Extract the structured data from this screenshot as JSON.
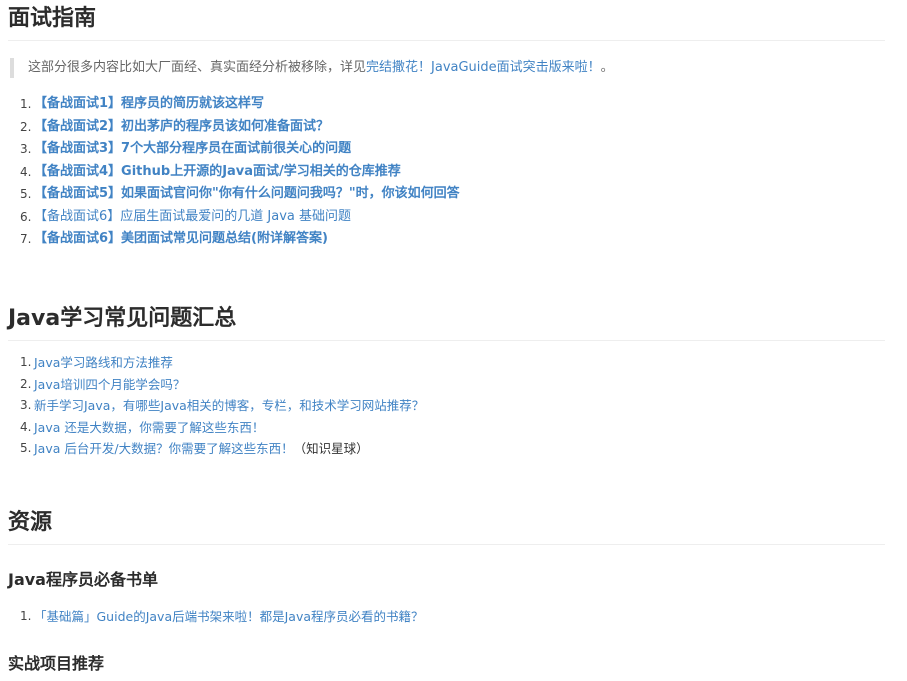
{
  "section1": {
    "title": "面试指南",
    "note": {
      "prefix": "这部分很多内容比如大厂面经、真实面经分析被移除，详见",
      "link": "完结撒花！JavaGuide面试突击版来啦！",
      "suffix": "。"
    },
    "items": [
      {
        "num": "1.",
        "text": "【备战面试1】程序员的简历就该这样写",
        "bold": true
      },
      {
        "num": "2.",
        "text": "【备战面试2】初出茅庐的程序员该如何准备面试？",
        "bold": true
      },
      {
        "num": "3.",
        "text": "【备战面试3】7个大部分程序员在面试前很关心的问题",
        "bold": true
      },
      {
        "num": "4.",
        "text": "【备战面试4】Github上开源的Java面试/学习相关的仓库推荐",
        "bold": true
      },
      {
        "num": "5.",
        "text": "【备战面试5】如果面试官问你\"你有什么问题问我吗？\"时，你该如何回答",
        "bold": true
      },
      {
        "num": "6.",
        "text": "【备战面试6】应届生面试最爱问的几道 Java 基础问题",
        "bold": false
      },
      {
        "num": "7.",
        "text": "【备战面试6】美团面试常见问题总结(附详解答案)",
        "bold": true
      }
    ]
  },
  "section2": {
    "title": "Java学习常见问题汇总",
    "items": [
      {
        "num": "1.",
        "text": "Java学习路线和方法推荐",
        "suffix": ""
      },
      {
        "num": "2.",
        "text": "Java培训四个月能学会吗？",
        "suffix": ""
      },
      {
        "num": "3.",
        "text": "新手学习Java，有哪些Java相关的博客，专栏，和技术学习网站推荐？",
        "suffix": ""
      },
      {
        "num": "4.",
        "text": "Java 还是大数据，你需要了解这些东西！",
        "suffix": ""
      },
      {
        "num": "5.",
        "text": "Java 后台开发/大数据？你需要了解这些东西！",
        "suffix": "（知识星球）"
      }
    ]
  },
  "section3": {
    "title": "资源",
    "sub1": {
      "title": "Java程序员必备书单",
      "items": [
        {
          "num": "1.",
          "text": "「基础篇」Guide的Java后端书架来啦！都是Java程序员必看的书籍？"
        }
      ]
    },
    "sub2": {
      "title": "实战项目推荐"
    }
  },
  "colors": {
    "link": "#4183c4",
    "heading": "#2c2c2c",
    "quote_bar": "#dddddd"
  }
}
